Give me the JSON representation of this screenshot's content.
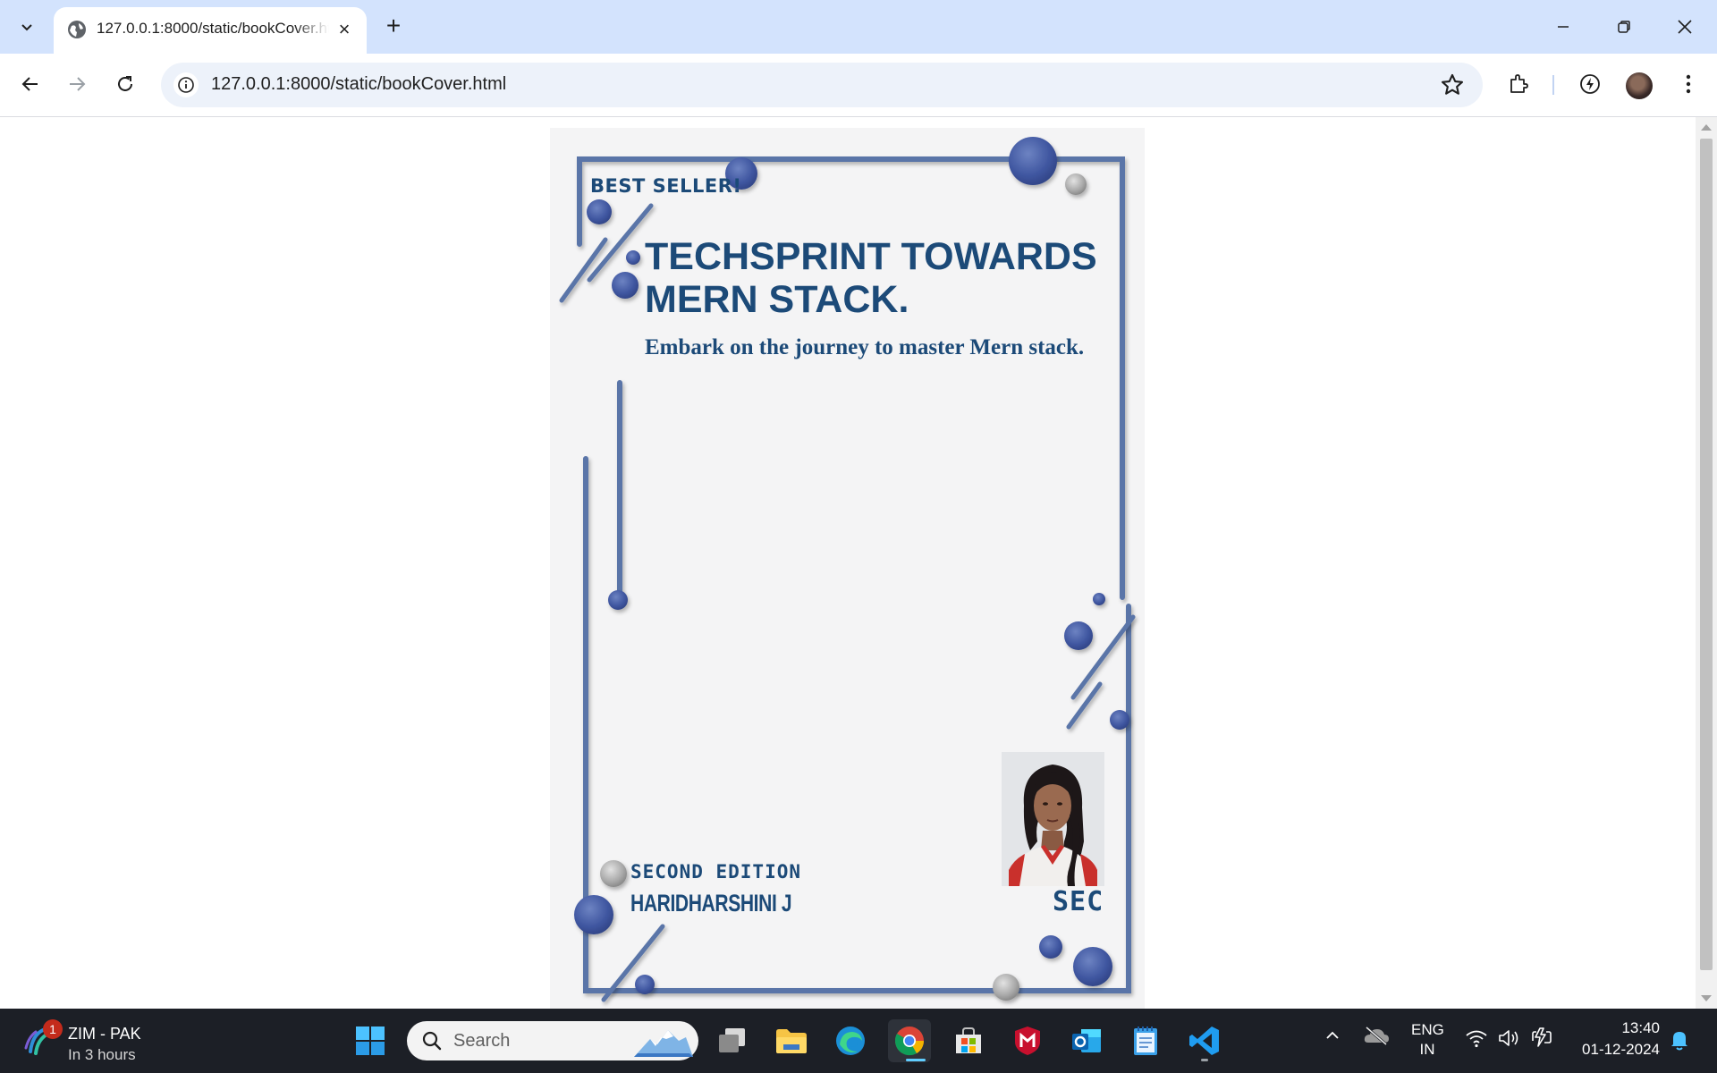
{
  "browser": {
    "tab_title": "127.0.0.1:8000/static/bookCover.html",
    "new_tab_label": "+",
    "url": "127.0.0.1:8000/static/bookCover.html"
  },
  "cover": {
    "badge": "BEST SELLER!",
    "title": "TECHSPRINT TOWARDS MERN STACK.",
    "subtitle": "Embark on the journey to master Mern stack.",
    "edition": "SECOND EDITION",
    "author": "HARIDHARSHINI J",
    "publisher": "SEC",
    "colors": {
      "text": "#1c4a78",
      "accent": "#4a62a6",
      "frame": "#5a74a8",
      "background": "#f4f4f5"
    }
  },
  "taskbar": {
    "weather_badge": "1",
    "weather_title": "ZIM - PAK",
    "weather_subtitle": "In 3 hours",
    "search_placeholder": "Search",
    "language_line1": "ENG",
    "language_line2": "IN",
    "time": "13:40",
    "date": "01-12-2024"
  }
}
